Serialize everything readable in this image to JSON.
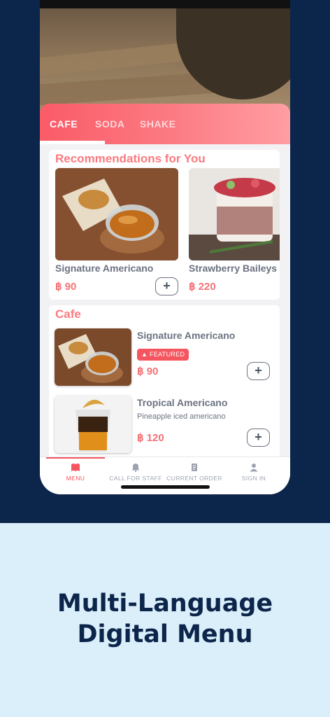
{
  "colors": {
    "accent": "#f5555f",
    "navy": "#0c254a",
    "light_bg": "#dbeffb"
  },
  "tabs": [
    {
      "label": "CAFE",
      "active": true
    },
    {
      "label": "SODA",
      "active": false
    },
    {
      "label": "SHAKE",
      "active": false
    }
  ],
  "recommendations": {
    "title": "Recommendations for You",
    "items": [
      {
        "name": "Signature Americano",
        "price": "฿ 90"
      },
      {
        "name": "Strawberry Baileys",
        "price": "฿ 220"
      }
    ]
  },
  "cafe": {
    "title": "Cafe",
    "items": [
      {
        "name": "Signature Americano",
        "badge": "FEATURED",
        "price": "฿ 90"
      },
      {
        "name": "Tropical Americano",
        "description": "Pineapple iced americano",
        "price": "฿ 120"
      }
    ]
  },
  "add_label": "+",
  "nav": [
    {
      "label": "MENU",
      "icon": "book-icon",
      "active": true
    },
    {
      "label": "CALL FOR STAFF",
      "icon": "bell-icon",
      "active": false
    },
    {
      "label": "CURRENT ORDER",
      "icon": "receipt-icon",
      "active": false
    },
    {
      "label": "SIGN IN",
      "icon": "user-icon",
      "active": false
    }
  ],
  "tagline": {
    "line1": "Multi-Language",
    "line2": "Digital Menu"
  }
}
